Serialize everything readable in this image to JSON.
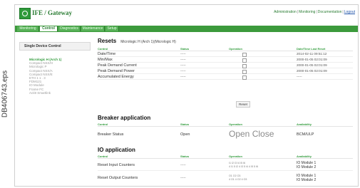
{
  "side_label": "DB406743.eps",
  "header": {
    "title": "IFE / Gateway",
    "links": [
      "Administration",
      "Monitoring",
      "Documentation",
      "Logout"
    ],
    "sep": "|"
  },
  "tabs": [
    {
      "label": "Monitoring"
    },
    {
      "label": "Control"
    },
    {
      "label": "Diagnostics"
    },
    {
      "label": "Maintenance"
    },
    {
      "label": "Setup"
    }
  ],
  "sidebar": {
    "heading": "Single Device Control",
    "items": [
      "Micrologic H (Arch 1)",
      "Compact NSX/H",
      "Micrologic P",
      "Compact NSX/A",
      "Compact NSX/E",
      "ETH 1 1 . 3",
      "FDM121",
      "IO Module",
      "Frame FC",
      "Acti9 Smartlink"
    ]
  },
  "resets": {
    "title": "Resets",
    "subtitle": "Micrologic H (Arch 1)(Micrologic H)",
    "headers": [
      "Control",
      "Status",
      "Operation",
      "Date/Time Last Reset"
    ],
    "rows": [
      {
        "control": "Date/Time",
        "status": "-----",
        "last": "2014-02-11 09:51:12"
      },
      {
        "control": "Min/Max",
        "status": "-----",
        "last": "2000-01-05 02:01:09"
      },
      {
        "control": "Peak Demand Current",
        "status": "-----",
        "last": "2000-01-05 02:01:09"
      },
      {
        "control": "Peak Demand Power",
        "status": "-----",
        "last": "2000-01-05 02:01:09"
      },
      {
        "control": "Accumulated Energy",
        "status": "-----",
        "last": "-----"
      }
    ],
    "reset_button": "Reset"
  },
  "breaker": {
    "title": "Breaker application",
    "headers": [
      "Control",
      "Status",
      "Operation",
      "Availability"
    ],
    "row": {
      "control": "Breaker Status",
      "status": "Open",
      "operation": "Open  Close",
      "availability": "BCM/ULP"
    }
  },
  "io": {
    "title": "IO application",
    "headers": [
      "Control",
      "Status",
      "Operation",
      "Availability"
    ],
    "rows": [
      {
        "control": "Reset Input Counters",
        "status": "-----",
        "op_line1": "I1     I2     I3     I4     I5     I6",
        "op_line2": "4 I1  5 I2  4 I3  5 I4  4 I5  5 I6",
        "avail1": "IO Module 1",
        "avail2": "IO Module 2"
      },
      {
        "control": "Reset Output Counters",
        "status": "-----",
        "op_line1": "O1     O2     O3",
        "op_line2": "4 O1  4 O2  4 O3",
        "avail1": "IO Module 1",
        "avail2": "IO Module 2"
      }
    ]
  }
}
